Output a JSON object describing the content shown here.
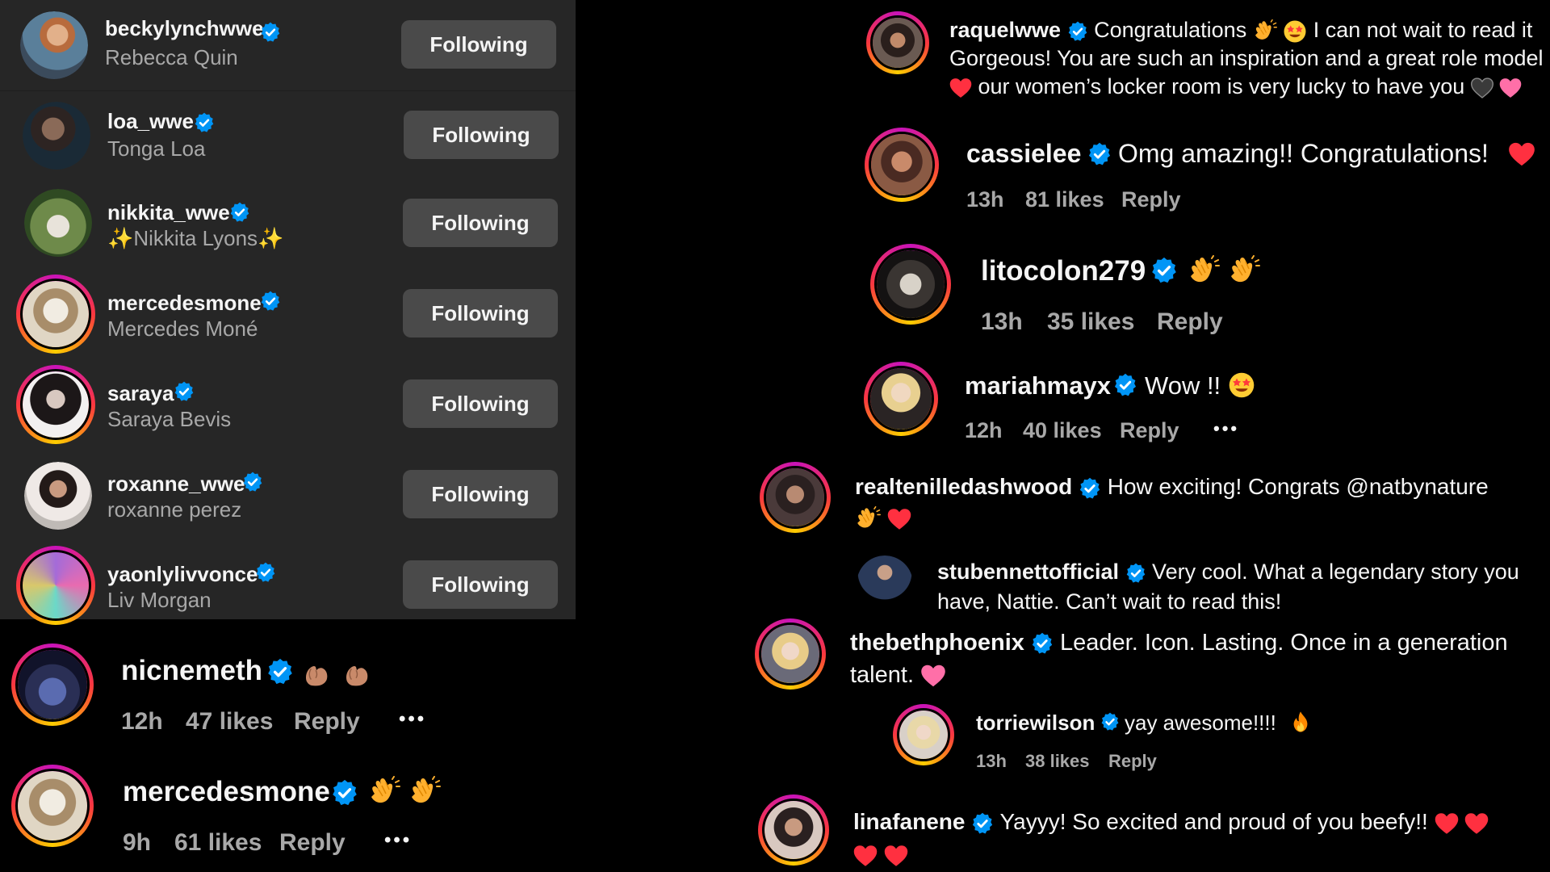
{
  "following_list": {
    "rows": [
      {
        "username": "beckylynchwwe",
        "full_name": "Rebecca Quin",
        "button": "Following"
      },
      {
        "username": "loa_wwe",
        "full_name": "Tonga Loa",
        "button": "Following"
      },
      {
        "username": "nikkita_wwe",
        "full_name": "✨Nikkita Lyons✨",
        "button": "Following"
      },
      {
        "username": "mercedesmone",
        "full_name": "Mercedes Moné",
        "button": "Following"
      },
      {
        "username": "saraya",
        "full_name": "Saraya Bevis",
        "button": "Following"
      },
      {
        "username": "roxanne_wwe",
        "full_name": "roxanne perez",
        "button": "Following"
      },
      {
        "username": "yaonlylivvonce",
        "full_name": "Liv Morgan",
        "button": "Following"
      }
    ]
  },
  "left_comments": [
    {
      "username": "nicnemeth",
      "time": "12h",
      "likes": "47 likes",
      "reply": "Reply",
      "more": "•••"
    },
    {
      "username": "mercedesmone",
      "time": "9h",
      "likes": "61 likes",
      "reply": "Reply",
      "more": "•••"
    }
  ],
  "comments": {
    "raquel": {
      "username": "raquelwwe",
      "text1": "Congratulations",
      "text2": "I can not wait to read it",
      "line2": "Gorgeous! You are such an inspiration and a great role model",
      "line3": "our women’s locker room is very lucky to have you"
    },
    "cassie": {
      "username": "cassielee",
      "text": "Omg amazing!! Congratulations!",
      "time": "13h",
      "likes": "81 likes",
      "reply": "Reply"
    },
    "lito": {
      "username": "litocolon279",
      "time": "13h",
      "likes": "35 likes",
      "reply": "Reply"
    },
    "mariah": {
      "username": "mariahmayx",
      "text": "Wow !!",
      "time": "12h",
      "likes": "40 likes",
      "reply": "Reply",
      "more": "•••"
    },
    "tenille": {
      "username": "realtenilledashwood",
      "text": "How exciting! Congrats @natbynature"
    },
    "stu": {
      "username": "stubennettofficial",
      "text": "Very cool. What a legendary story you",
      "line2": "have, Nattie. Can’t wait to read this!"
    },
    "beth": {
      "username": "thebethphoenix",
      "text": "Leader. Icon. Lasting. Once in a generation",
      "line2": "talent."
    },
    "torrie": {
      "username": "torriewilson",
      "text": "yay awesome!!!!",
      "time": "13h",
      "likes": "38 likes",
      "reply": "Reply"
    },
    "lina": {
      "username": "linafanene",
      "text": "Yayyy! So excited and proud of you beefy!!"
    }
  },
  "colors": {
    "verified": "#0095f6",
    "panel_bg": "#262626",
    "button_bg": "#4a4a4a",
    "meta_text": "#a8a8a8",
    "heart": "#ff3040"
  }
}
